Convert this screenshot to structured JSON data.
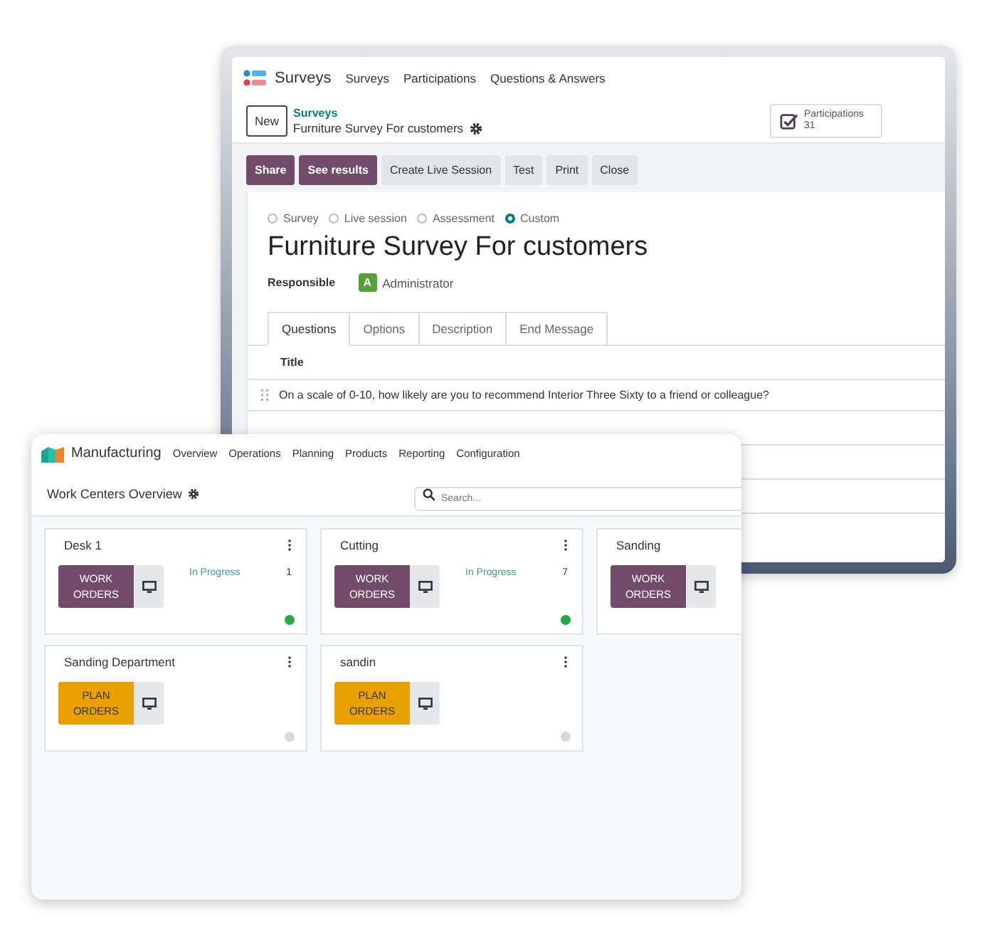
{
  "surveys_window": {
    "app_name": "Surveys",
    "menu": [
      "Surveys",
      "Participations",
      "Questions & Answers"
    ],
    "new_button": "New",
    "breadcrumb": "Surveys",
    "record_name": "Furniture Survey For customers",
    "stat": {
      "label": "Participations",
      "value": "31"
    },
    "actions": [
      {
        "label": "Share",
        "kind": "primary"
      },
      {
        "label": "See results",
        "kind": "primary"
      },
      {
        "label": "Create Live Session",
        "kind": "secondary"
      },
      {
        "label": "Test",
        "kind": "secondary"
      },
      {
        "label": "Print",
        "kind": "secondary"
      },
      {
        "label": "Close",
        "kind": "secondary"
      }
    ],
    "survey_types": [
      {
        "label": "Survey",
        "selected": false
      },
      {
        "label": "Live session",
        "selected": false
      },
      {
        "label": "Assessment",
        "selected": false
      },
      {
        "label": "Custom",
        "selected": true
      }
    ],
    "title": "Furniture Survey For customers",
    "responsible": {
      "label": "Responsible",
      "avatar": "A",
      "name": "Administrator"
    },
    "tabs": [
      {
        "label": "Questions",
        "selected": true
      },
      {
        "label": "Options",
        "selected": false
      },
      {
        "label": "Description",
        "selected": false
      },
      {
        "label": "End Message",
        "selected": false
      }
    ],
    "table": {
      "columns": [
        "Title"
      ],
      "rows": [
        {
          "title": "On a scale of 0-10, how likely are you to recommend Interior Three Sixty to a friend or colleague?"
        }
      ]
    }
  },
  "manufacturing_window": {
    "app_name": "Manufacturing",
    "menu": [
      "Overview",
      "Operations",
      "Planning",
      "Products",
      "Reporting",
      "Configuration"
    ],
    "page_title": "Work Centers Overview",
    "search": {
      "placeholder": "Search..."
    },
    "work_centers": [
      {
        "name": "Desk 1",
        "kind": "work",
        "button": "WORK ORDERS",
        "status": "In Progress",
        "count": "1",
        "color": "#28a745"
      },
      {
        "name": "Cutting",
        "kind": "work",
        "button": "WORK ORDERS",
        "status": "In Progress",
        "count": "7",
        "color": "#28a745"
      },
      {
        "name": "Sanding",
        "kind": "work",
        "button": "WORK ORDERS"
      },
      {
        "name": "Sanding Department",
        "kind": "plan",
        "button": "PLAN ORDERS",
        "color": "#d8d8d8"
      },
      {
        "name": "sandin",
        "kind": "plan",
        "button": "PLAN ORDERS",
        "color": "#d8d8d8"
      }
    ]
  }
}
